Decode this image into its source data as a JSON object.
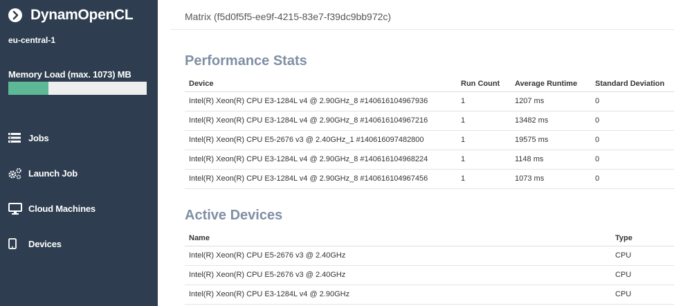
{
  "sidebar": {
    "brand": "DynamOpenCL",
    "region": "eu-central-1",
    "memory": {
      "label": "Memory Load (max. 1073) MB",
      "fill_fraction": 0.29,
      "fill_color": "#5cb895"
    },
    "nav": [
      {
        "label": "Jobs",
        "icon": "list-icon"
      },
      {
        "label": "Launch Job",
        "icon": "gears-icon"
      },
      {
        "label": "Cloud Machines",
        "icon": "monitor-icon"
      },
      {
        "label": "Devices",
        "icon": "tablet-icon"
      }
    ]
  },
  "main": {
    "matrix_title": "Matrix (f5d0f5f5-ee9f-4215-83e7-f39dc9bb972c)",
    "performance": {
      "title": "Performance Stats",
      "headers": [
        "Device",
        "Run Count",
        "Average Runtime",
        "Standard Deviation"
      ],
      "rows": [
        [
          "Intel(R) Xeon(R) CPU E3-1284L v4 @ 2.90GHz_8 #140616104967936",
          "1",
          "1207 ms",
          "0"
        ],
        [
          "Intel(R) Xeon(R) CPU E3-1284L v4 @ 2.90GHz_8 #140616104967216",
          "1",
          "13482 ms",
          "0"
        ],
        [
          "Intel(R) Xeon(R) CPU E5-2676 v3 @ 2.40GHz_1 #140616097482800",
          "1",
          "19575 ms",
          "0"
        ],
        [
          "Intel(R) Xeon(R) CPU E3-1284L v4 @ 2.90GHz_8 #140616104968224",
          "1",
          "1148 ms",
          "0"
        ],
        [
          "Intel(R) Xeon(R) CPU E3-1284L v4 @ 2.90GHz_8 #140616104967456",
          "1",
          "1073 ms",
          "0"
        ]
      ]
    },
    "devices": {
      "title": "Active Devices",
      "headers": [
        "Name",
        "Type"
      ],
      "rows": [
        [
          "Intel(R) Xeon(R) CPU E5-2676 v3 @ 2.40GHz",
          "CPU"
        ],
        [
          "Intel(R) Xeon(R) CPU E5-2676 v3 @ 2.40GHz",
          "CPU"
        ],
        [
          "Intel(R) Xeon(R) CPU E3-1284L v4 @ 2.90GHz",
          "CPU"
        ]
      ]
    }
  }
}
